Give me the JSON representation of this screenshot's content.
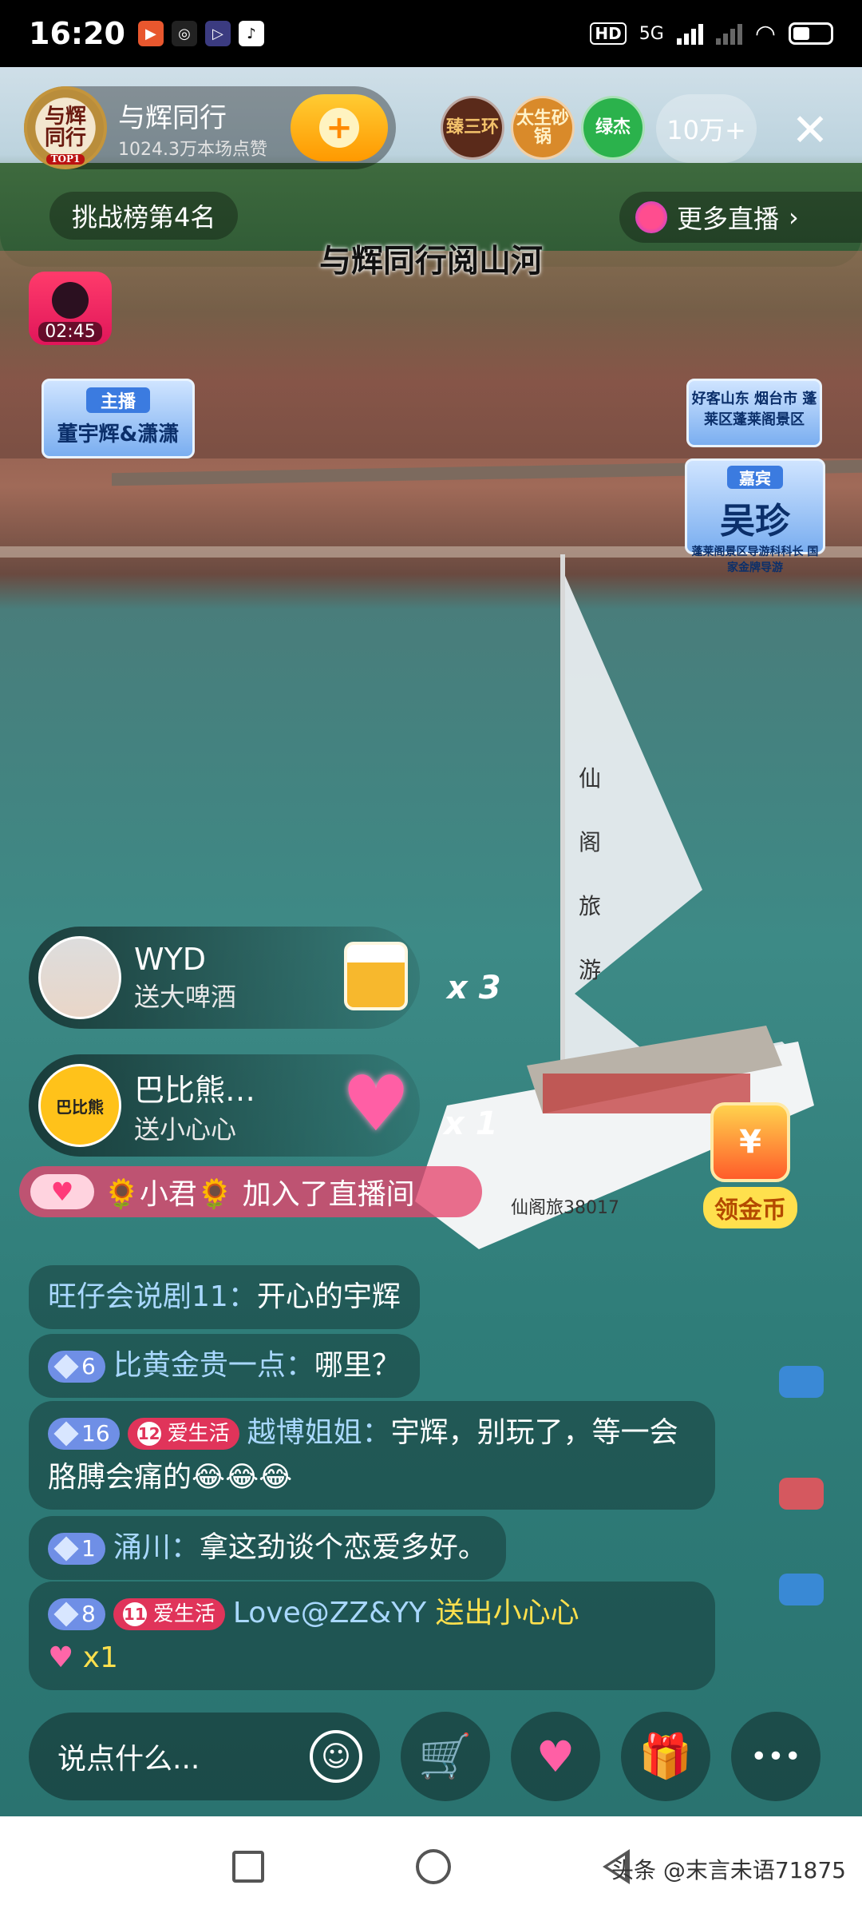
{
  "status_bar": {
    "time": "16:20",
    "network_badge": "HD",
    "signal_label": "5G"
  },
  "host": {
    "avatar_text": "与辉同行",
    "avatar_rank": "TOP1",
    "name": "与辉同行",
    "likes": "1024.3万本场点赞",
    "follow_icon": "+"
  },
  "top_viewers": [
    "臻三环",
    "太生砂锅",
    "绿杰"
  ],
  "viewer_count": "10万+",
  "close_icon": "✕",
  "rank_badge": "挑战榜第4名",
  "more_live": "更多直播",
  "more_live_chevron": "›",
  "timer": "02:45",
  "video": {
    "title_overlay": "与辉同行阅山河",
    "host_sign_tag": "主播",
    "host_sign": "董宇辉&潇潇",
    "location_sign": "好客山东 烟台市 蓬莱区蓬莱阁景区",
    "guest_tag": "嘉宾",
    "guest_name": "吴珍",
    "guest_title": "蓬莱阁景区导游科科长 国家金牌导游",
    "sail_text": "仙阁旅游",
    "boat_id": "仙阁旅38017",
    "combo_1": "x 3",
    "combo_2": "x 1"
  },
  "gifts": [
    {
      "user": "WYD",
      "desc": "送大啤酒",
      "icon": "beer-icon"
    },
    {
      "user": "巴比熊…",
      "avatar_text": "巴比熊",
      "desc": "送小心心",
      "icon": "heart-icon"
    }
  ],
  "join_notice": {
    "user": "🌻小君🌻",
    "text": "加入了直播间"
  },
  "coin_button": {
    "icon_text": "¥",
    "label": "领金币"
  },
  "chat": [
    {
      "user": "旺仔会说剧11：",
      "text": "开心的宇辉"
    },
    {
      "level": "6",
      "user": "比黄金贵一点：",
      "text": "哪里？"
    },
    {
      "level": "16",
      "fan_level": "12",
      "fan_name": "爱生活",
      "user": "越博姐姐：",
      "text": "宇辉，别玩了，等一会胳膊会痛的😂😂😂"
    },
    {
      "level": "1",
      "user": "涌川：",
      "text": "拿这劲谈个恋爱多好。"
    },
    {
      "level": "8",
      "fan_level": "11",
      "fan_name": "爱生活",
      "user": "Love@ZZ&YY",
      "text": "送出小心心",
      "count": "x1"
    }
  ],
  "bottom_bar": {
    "placeholder": "说点什么...",
    "emoji_icon": "☺",
    "cart_icon": "🛒",
    "heart_icon": "♥",
    "gift_icon": "🎁",
    "more_icon": "•••"
  },
  "watermark": "头条 @末言未语71875",
  "colors": {
    "accent_pink": "#e0345a",
    "username_blue": "#a9d8ff",
    "coin_gold": "#ffe04d",
    "follow_orange": "#ff9900"
  }
}
